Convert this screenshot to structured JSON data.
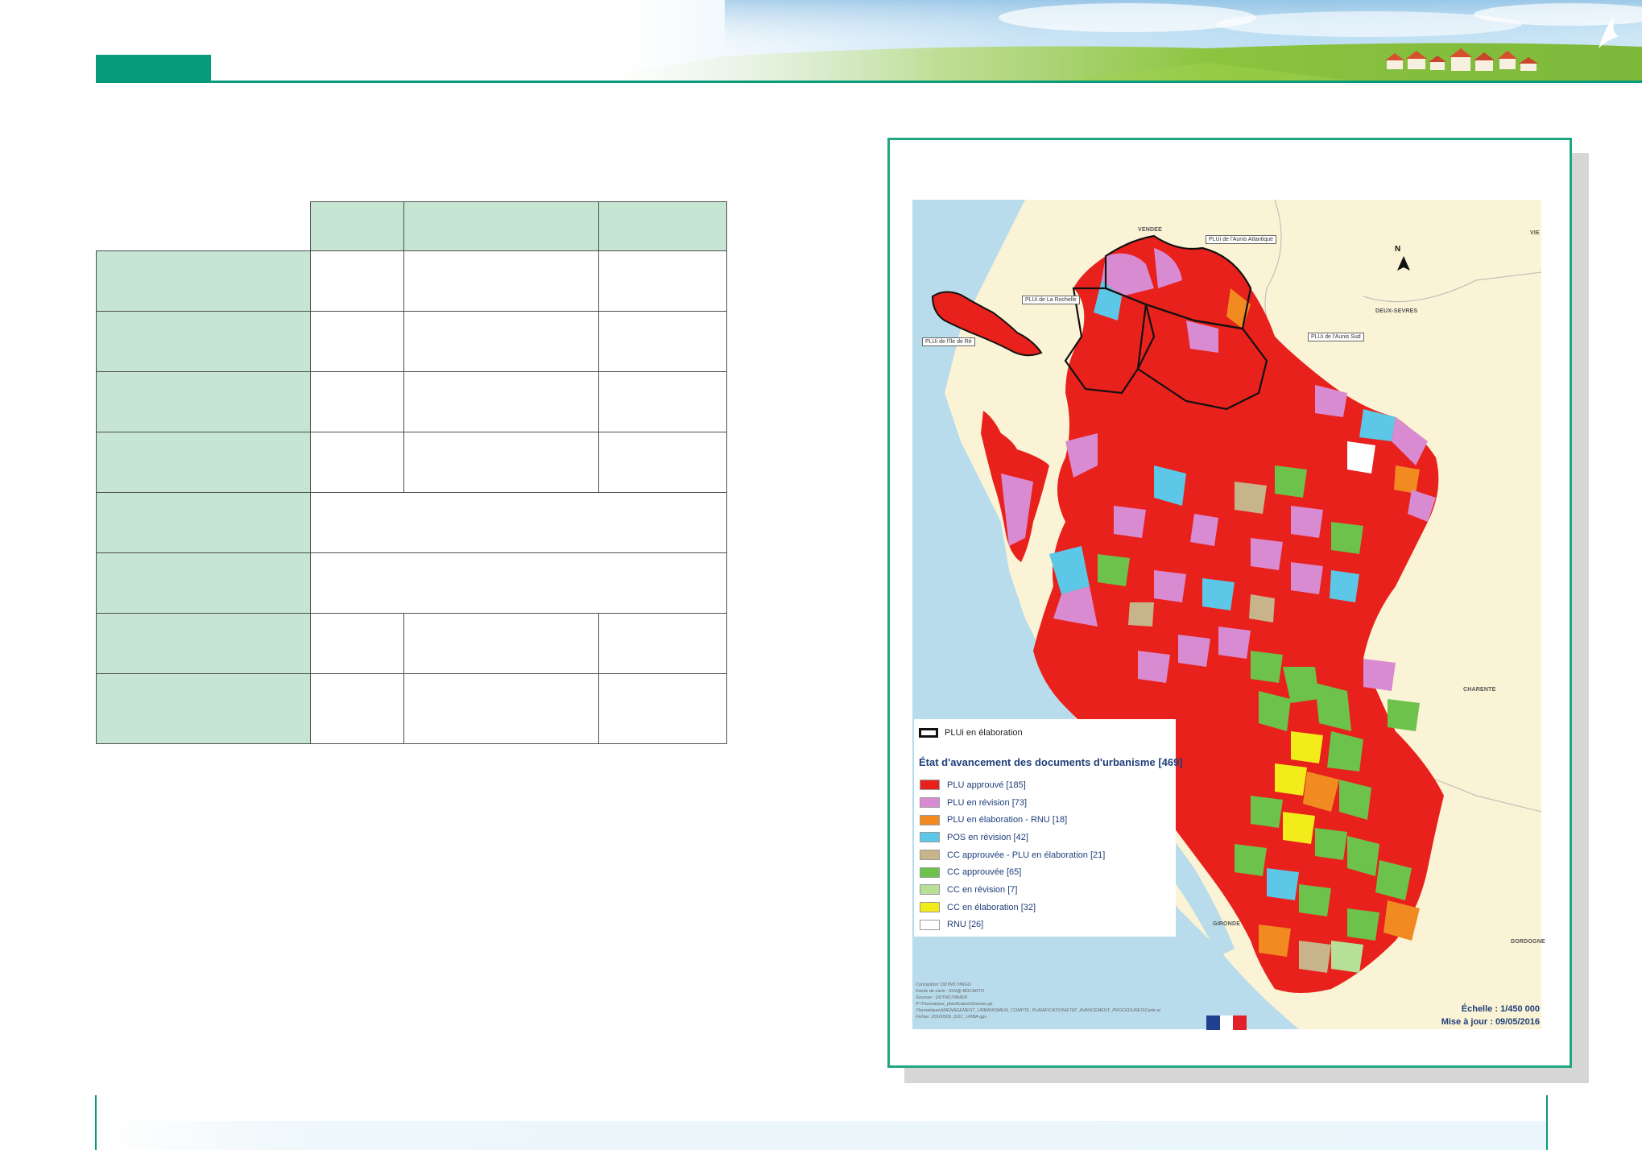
{
  "page": {
    "accent_color": "#079b7c",
    "table_fill_color": "#c6e6d3"
  },
  "table": {
    "header_cells": [
      "",
      "",
      ""
    ],
    "rows": [
      {
        "label": "",
        "cells": [
          "",
          "",
          ""
        ]
      },
      {
        "label": "",
        "cells": [
          "",
          "",
          ""
        ]
      },
      {
        "label": "",
        "cells": [
          "",
          "",
          ""
        ]
      },
      {
        "label": "",
        "cells": [
          "",
          "",
          ""
        ]
      },
      {
        "label": "",
        "merged": ""
      },
      {
        "label": "",
        "merged": ""
      },
      {
        "label": "",
        "cells": [
          "",
          "",
          ""
        ]
      },
      {
        "label": "",
        "cells": [
          "",
          "",
          ""
        ]
      }
    ]
  },
  "map": {
    "place_labels": {
      "vendee": "VENDEE",
      "deux_sevres": "DEUX-SEVRES",
      "charente": "CHARENTE",
      "gironde": "GIRONDE",
      "dordogne": "DORDOGNE",
      "vienne": "VIE"
    },
    "callouts": {
      "aunis_atlantique": "PLUi de l'Aunis Atlantique",
      "la_rochelle": "PLUi de La Rochelle",
      "ile_de_re": "PLUi de l'île de Ré",
      "aunis_sud": "PLUi de l'Aunis Sud"
    },
    "north_label": "N",
    "pluil_label": "PLUi en élaboration",
    "legend_title": "État d'avancement des documents d'urbanisme [469]",
    "legend": [
      {
        "label": "PLU approuvé [185]",
        "color": "#e8211c"
      },
      {
        "label": "PLU en révision [73]",
        "color": "#d98bd1"
      },
      {
        "label": "PLU en élaboration - RNU  [18]",
        "color": "#f08a21"
      },
      {
        "label": "POS en révision [42]",
        "color": "#5cc7e6"
      },
      {
        "label": "CC approuvée - PLU en élaboration  [21]",
        "color": "#c8b48a"
      },
      {
        "label": "CC approuvée  [65]",
        "color": "#6cc24a"
      },
      {
        "label": "CC en révision  [7]",
        "color": "#b6e098"
      },
      {
        "label": "CC en élaboration  [32]",
        "color": "#f2ec1b"
      },
      {
        "label": "RNU  [26]",
        "color": "#ffffff"
      }
    ],
    "credits": [
      "Conception: DDTM17/MIGO",
      "Fonds de carte : IGN@-BDCARTO",
      "Sources : DDTM17/AMEB",
      "P:\\Thematique_planification\\Dossier.pp",
      "Thematique\\AMENAGEMENT_URBANISME\\N_COMPTE_PLANIFICATION\\ETAT_AVANCEMENT_PROCEDURES\\Carte.ai",
      "Fichier: 20160509_DOC_URBA.qgs"
    ],
    "scale": "Échelle : 1/450 000",
    "update": "Mise à jour : 09/05/2016"
  }
}
